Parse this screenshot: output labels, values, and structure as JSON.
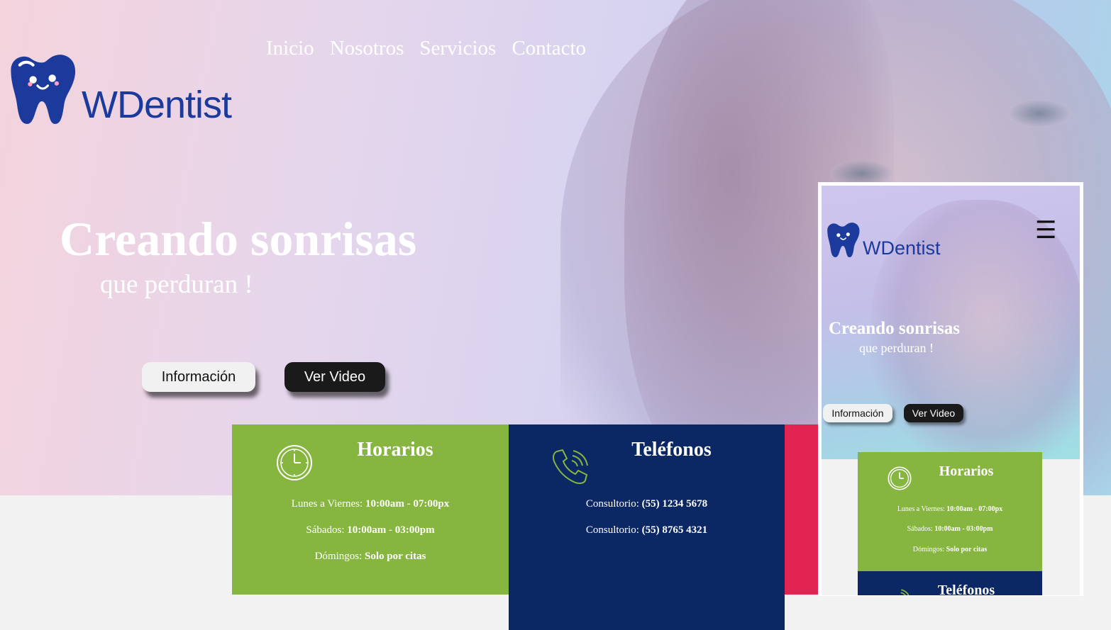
{
  "brand": {
    "name": "WDentist"
  },
  "nav": {
    "items": [
      "Inicio",
      "Nosotros",
      "Servicios",
      "Contacto"
    ]
  },
  "hero": {
    "headline": "Creando sonrisas",
    "subline": "que perduran !",
    "buttons": {
      "info": "Información",
      "video": "Ver Video"
    }
  },
  "cards": {
    "horarios": {
      "title": "Horarios",
      "icon": "clock-icon",
      "lines": [
        {
          "label": "Lunes a Viernes:",
          "value": "10:00am - 07:00px"
        },
        {
          "label": "Sábados:",
          "value": "10:00am - 03:00pm"
        },
        {
          "label": "Dómingos:",
          "value": "Solo por citas"
        }
      ]
    },
    "telefonos": {
      "title": "Teléfonos",
      "icon": "phone-icon",
      "lines": [
        {
          "label": "Consultorio:",
          "value": "(55) 1234 5678"
        },
        {
          "label": "Consultorio:",
          "value": "(55) 8765 4321"
        }
      ]
    }
  },
  "mobile_preview": {
    "brand": "WDentist",
    "menu_icon": "hamburger-icon",
    "headline": "Creando sonrisas",
    "subline": "que perduran !",
    "buttons": {
      "info": "Información",
      "video": "Ver Video"
    },
    "horarios_title": "Horarios",
    "horarios_lines": [
      {
        "label": "Lunes a Viernes:",
        "value": "10:00am - 07:00px"
      },
      {
        "label": "Sábados:",
        "value": "10:00am - 03:00pm"
      },
      {
        "label": "Dómingos:",
        "value": "Solo por citas"
      }
    ],
    "telefonos_title": "Teléfonos"
  },
  "colors": {
    "brand_blue": "#1b3a9c",
    "horarios_green": "#86b540",
    "telefonos_navy": "#0b2764",
    "accent_red": "#e12452"
  }
}
